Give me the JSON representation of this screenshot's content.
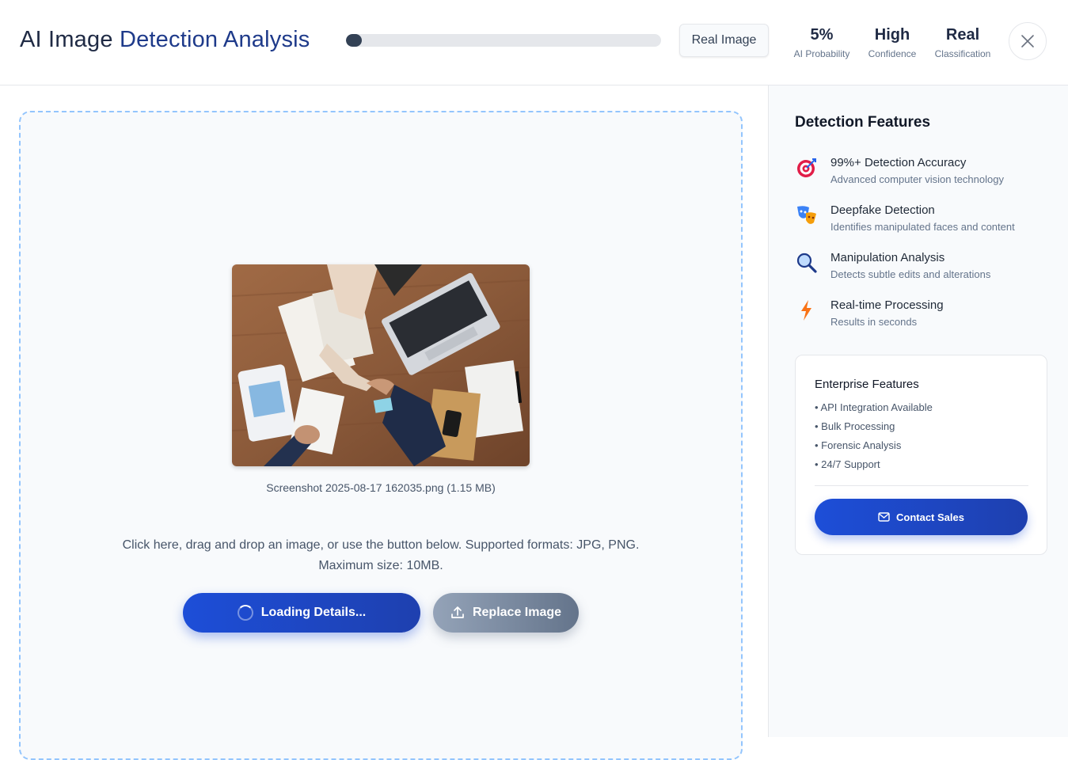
{
  "header": {
    "title_part1": "AI Image",
    "title_part2": "Detection Analysis",
    "progress_percent": 5,
    "badge": "Real Image",
    "stats": [
      {
        "value": "5%",
        "label": "AI Probability"
      },
      {
        "value": "High",
        "label": "Confidence"
      },
      {
        "value": "Real",
        "label": "Classification"
      }
    ]
  },
  "upload": {
    "filename": "Screenshot 2025-08-17 162035.png (1.15 MB)",
    "hint_line1": "Click here, drag and drop an image, or use the button below. Supported formats: JPG, PNG.",
    "hint_line2": "Maximum size: 10MB.",
    "primary_button": "Loading Details...",
    "secondary_button": "Replace Image"
  },
  "sidebar": {
    "title": "Detection Features",
    "features": [
      {
        "title": "99%+ Detection Accuracy",
        "desc": "Advanced computer vision technology",
        "icon": "target-icon"
      },
      {
        "title": "Deepfake Detection",
        "desc": "Identifies manipulated faces and content",
        "icon": "masks-icon"
      },
      {
        "title": "Manipulation Analysis",
        "desc": "Detects subtle edits and alterations",
        "icon": "magnifier-icon"
      },
      {
        "title": "Real-time Processing",
        "desc": "Results in seconds",
        "icon": "lightning-icon"
      }
    ],
    "enterprise": {
      "title": "Enterprise Features",
      "items": [
        "• API Integration Available",
        "• Bulk Processing",
        "• Forensic Analysis",
        "• 24/7 Support"
      ],
      "button": "Contact Sales"
    }
  },
  "colors": {
    "accent": "#1d4ed8",
    "title_accent": "#1e3a8a",
    "dashed_border": "#93c5fd"
  }
}
